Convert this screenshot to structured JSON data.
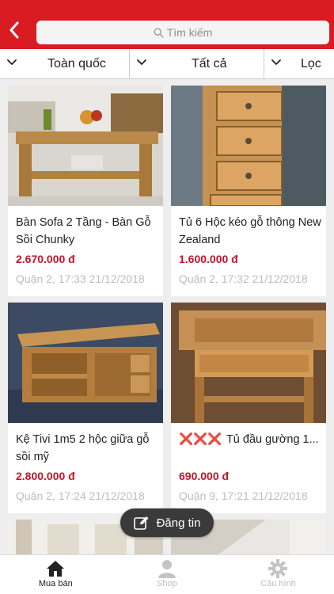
{
  "colors": {
    "accent": "#d91c22",
    "price": "#c2152b"
  },
  "header": {
    "back_icon": "chevron-left-icon",
    "search_placeholder": "Tìm kiếm"
  },
  "filters": [
    {
      "label": "Toàn quốc",
      "icon": "chevron-down-icon"
    },
    {
      "label": "Tất cả",
      "icon": "chevron-down-icon"
    },
    {
      "label": "Lọc",
      "icon": "chevron-down-icon"
    }
  ],
  "listings": [
    {
      "title": "Bàn Sofa 2 Tầng - Bàn Gỗ Sồi Chunky",
      "price": "2.670.000 đ",
      "meta": "Quận 2, 17:33 21/12/2018"
    },
    {
      "title": "Tủ 6 Hộc kéo gỗ thông New Zealand",
      "price": "1.600.000 đ",
      "meta": "Quận 2, 17:32 21/12/2018"
    },
    {
      "title": "Kệ Tivi 1m5 2 hộc giữa gỗ sồi mỹ",
      "price": "2.800.000 đ",
      "meta": "Quận 2, 17:24 21/12/2018"
    },
    {
      "title_marks": "❌❌❌",
      "title": "Tủ đầu gường 1...",
      "price": "690.000 đ",
      "meta": "Quận 9, 17:21 21/12/2018"
    }
  ],
  "post_button": {
    "label": "Đăng tin",
    "icon": "edit-icon"
  },
  "tabbar": [
    {
      "label": "Mua bán",
      "icon": "home-icon",
      "active": true
    },
    {
      "label": "Shop",
      "icon": "user-icon",
      "active": false
    },
    {
      "label": "Cấu hình",
      "icon": "gear-icon",
      "active": false
    }
  ]
}
